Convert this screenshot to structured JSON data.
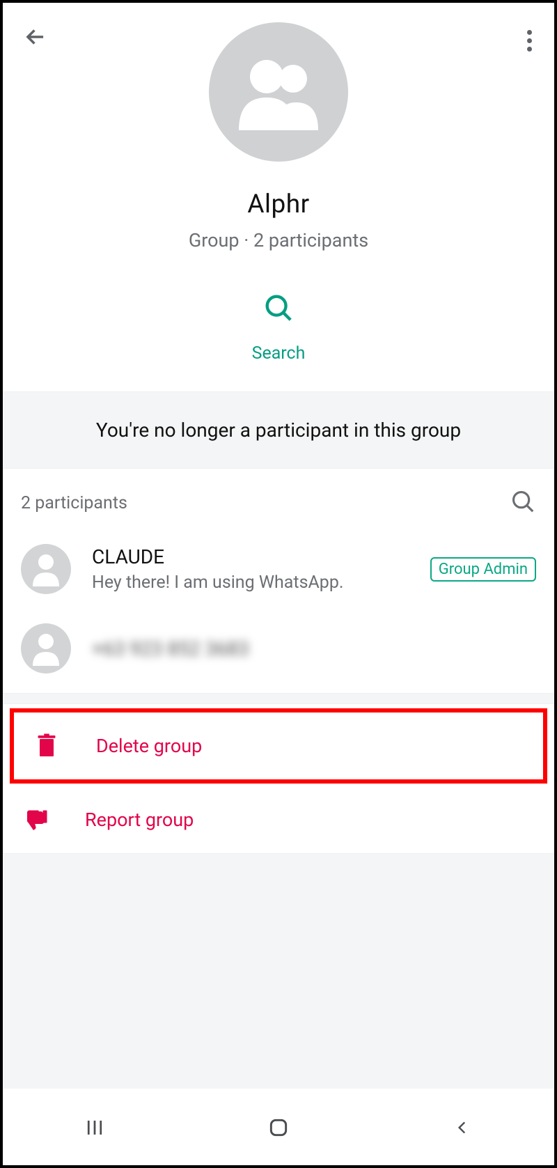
{
  "header": {
    "group_name": "Alphr",
    "group_subtitle": "Group · 2 participants"
  },
  "search": {
    "label": "Search"
  },
  "banner": {
    "text": "You're no longer a participant in this group"
  },
  "participants": {
    "count_label": "2 participants",
    "list": [
      {
        "name": "CLAUDE",
        "status": "Hey there! I am using WhatsApp.",
        "admin": true,
        "admin_label": "Group Admin"
      },
      {
        "name": "+63 923 852 3683",
        "status": "",
        "admin": false,
        "blurred": true
      }
    ]
  },
  "actions": {
    "delete": "Delete group",
    "report": "Report group"
  },
  "colors": {
    "accent": "#049e82",
    "danger": "#e2054a"
  }
}
